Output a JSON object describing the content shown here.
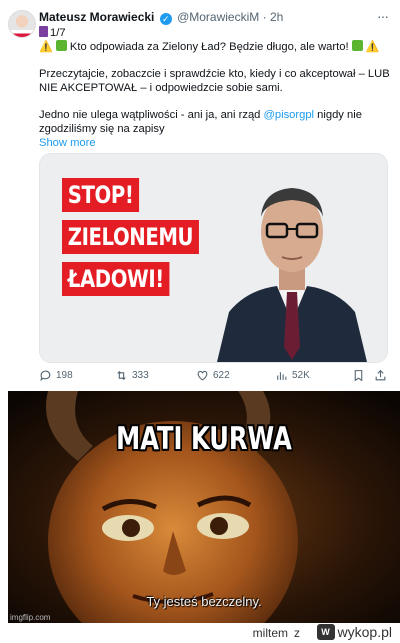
{
  "tweet": {
    "author_name": "Mateusz Morawiecki",
    "handle": "@MorawieckiM",
    "separator": "·",
    "time": "2h",
    "more": "···",
    "line1_counter": "1/7",
    "line2": "Kto odpowiada za Zielony Ład? Będzie długo, ale warto!",
    "para2": "Przeczytajcie, zobaczcie i sprawdźcie kto, kiedy i co akceptował – LUB NIE AKCEPTOWAŁ – i odpowiedzcie sobie sami.",
    "para3_before": "Jedno nie ulega wątpliwości - ani ja, ani rząd ",
    "para3_mention": "@pisorgpl",
    "para3_after": " nigdy nie zgodziliśmy się na zapisy",
    "show_more": "Show more",
    "media": {
      "line1": "STOP!",
      "line2": "ZIELONEMU",
      "line3": "ŁADOWI!"
    },
    "actions": {
      "replies": "198",
      "retweets": "333",
      "likes": "622",
      "views": "52K"
    }
  },
  "meme": {
    "title": "MATI KURWA",
    "subtitle": "Ty jesteś bezczelny.",
    "watermark": "imgflip.com"
  },
  "footer": {
    "user": "miltem",
    "z": "z",
    "site": "wykop.pl"
  },
  "colors": {
    "link": "#1d9bf0",
    "stop_red": "#e41d24",
    "text_secondary": "#536471"
  }
}
